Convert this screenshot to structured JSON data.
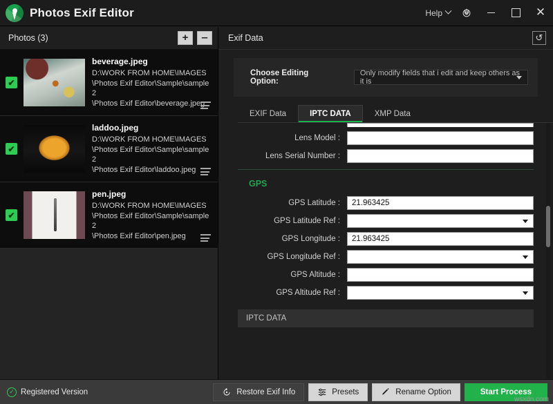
{
  "titlebar": {
    "app_title": "Photos Exif Editor",
    "logo_icon": "aperture-logo-icon",
    "help_label": "Help",
    "gear_icon": "gear-icon",
    "minimize_icon": "minimize-icon",
    "maximize_icon": "maximize-icon",
    "close_icon": "close-icon",
    "close_glyph": "✕"
  },
  "left_panel": {
    "header_label": "Photos (3)",
    "add_label": "+",
    "remove_label": "‒",
    "photos": [
      {
        "name": "beverage.jpeg",
        "path": "D:\\WORK FROM HOME\\IMAGES\n\\Photos Exif Editor\\Sample\\sample 2\n\\Photos Exif Editor\\beverage.jpeg",
        "checked": true,
        "thumb_class": "beverage"
      },
      {
        "name": "laddoo.jpeg",
        "path": "D:\\WORK FROM HOME\\IMAGES\n\\Photos Exif Editor\\Sample\\sample 2\n\\Photos Exif Editor\\laddoo.jpeg",
        "checked": true,
        "thumb_class": "laddoo"
      },
      {
        "name": "pen.jpeg",
        "path": "D:\\WORK FROM HOME\\IMAGES\n\\Photos Exif Editor\\Sample\\sample 2\n\\Photos Exif Editor\\pen.jpeg",
        "checked": true,
        "thumb_class": "pen"
      }
    ],
    "check_glyph": "✔",
    "row_menu_icon": "row-menu-icon"
  },
  "right_panel": {
    "header_label": "Exif Data",
    "reset_icon": "reset-icon",
    "reset_glyph": "↺",
    "editing_option": {
      "label": "Choose Editing Option:",
      "value": "Only modify fields that i edit and keep others as it is"
    },
    "tabs": [
      {
        "label": "EXIF Data",
        "active": false
      },
      {
        "label": "IPTC DATA",
        "active": true
      },
      {
        "label": "XMP Data",
        "active": false
      }
    ],
    "fields_top": [
      {
        "label": "Lens Model :",
        "value": "",
        "type": "text"
      },
      {
        "label": "Lens Serial Number :",
        "value": "",
        "type": "text"
      }
    ],
    "gps_group_title": "GPS",
    "gps_fields": [
      {
        "label": "GPS Latitude :",
        "value": "21.963425",
        "type": "text"
      },
      {
        "label": "GPS Latitude Ref :",
        "value": "",
        "type": "select"
      },
      {
        "label": "GPS Longitude :",
        "value": "21.963425",
        "type": "text"
      },
      {
        "label": "GPS Longitude Ref :",
        "value": "",
        "type": "select"
      },
      {
        "label": "GPS Altitude :",
        "value": "",
        "type": "text"
      },
      {
        "label": "GPS Altitude Ref :",
        "value": "",
        "type": "select"
      }
    ],
    "section_bar_label": "IPTC DATA"
  },
  "bottom_bar": {
    "registered_label": "Registered Version",
    "registered_icon": "check-circle-icon",
    "registered_glyph": "✓",
    "restore_label": "Restore Exif Info",
    "restore_icon": "restore-icon",
    "presets_label": "Presets",
    "presets_icon": "sliders-icon",
    "rename_label": "Rename Option",
    "rename_icon": "pencil-icon",
    "start_label": "Start Process",
    "watermark": "wsxdn.com"
  },
  "colors": {
    "accent_green": "#21b24b",
    "tab_underline": "#1eb152",
    "group_title": "#23a34f",
    "checkbox_green": "#2ecc52"
  }
}
